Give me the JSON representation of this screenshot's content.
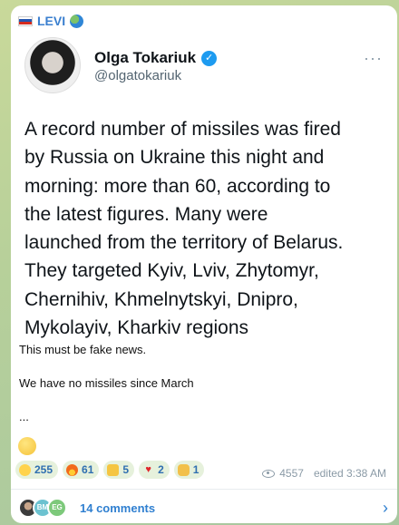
{
  "channel": {
    "name": "LEVI"
  },
  "tweet": {
    "author_name": "Olga Tokariuk",
    "author_handle": "@olgatokariuk",
    "more_label": "···",
    "lines": [
      "A record number of missiles was fired",
      "by Russia on Ukraine this night and",
      "morning: more than 60, according to",
      "the latest figures. Many were",
      "launched from the territory of Belarus.",
      "They targeted Kyiv, Lviv, Zhytomyr,",
      "Chernihiv, Khmelnytskyi, Dnipro,",
      "Mykolayiv, Kharkiv regions"
    ]
  },
  "message": {
    "line1": "This must be fake news.",
    "line2": "We have no missiles since March",
    "line3": "..."
  },
  "reactions": [
    {
      "icon": "grin-emoji-icon",
      "count": "255"
    },
    {
      "icon": "fire-emoji-icon",
      "count": "61"
    },
    {
      "icon": "thumbs-up-emoji-icon",
      "count": "5"
    },
    {
      "icon": "heart-emoji-icon",
      "count": "2"
    },
    {
      "icon": "clap-emoji-icon",
      "count": "1"
    }
  ],
  "meta": {
    "views": "4557",
    "edited": "edited 3:38 AM"
  },
  "comments": {
    "avatars": [
      "",
      "BM",
      "EG"
    ],
    "label": "14 comments"
  },
  "colors": {
    "accent": "#2f7fd0",
    "bubble": "#ffffff",
    "reaction_bg": "#e6f1dc"
  }
}
